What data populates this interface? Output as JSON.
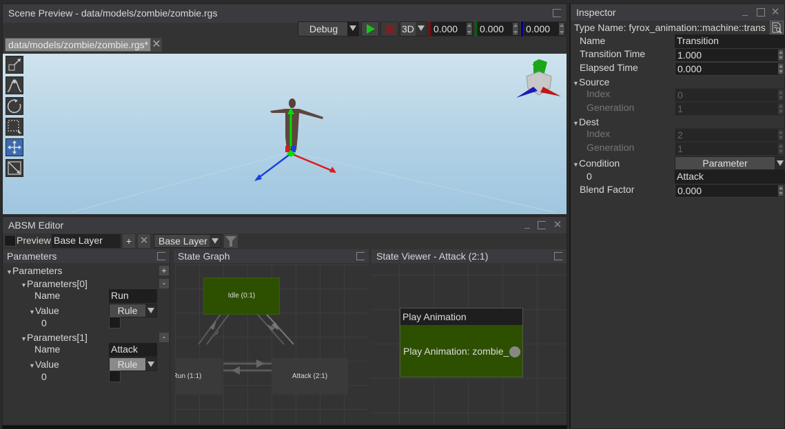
{
  "scene_preview": {
    "title": "Scene Preview - data/models/zombie/zombie.rgs",
    "mode_dropdown": "Debug",
    "play_icon": "play-icon",
    "stop_icon": "stop-icon",
    "view_dropdown": "3D",
    "coords": {
      "x": "0.000",
      "y": "0.000",
      "z": "0.000"
    },
    "axis_colors": {
      "x": "#8b0000",
      "y": "#006400",
      "z": "#00008b"
    },
    "tab": {
      "label": "data/models/zombie/zombie.rgs*",
      "close_icon": "close-icon"
    },
    "tools": [
      {
        "name": "select-link-tool",
        "icon": "link-icon",
        "active": false
      },
      {
        "name": "terrain-tool",
        "icon": "mountain-icon",
        "active": false
      },
      {
        "name": "rotate-tool",
        "icon": "rotate-icon",
        "active": false
      },
      {
        "name": "select-rect-tool",
        "icon": "select-rect-icon",
        "active": false
      },
      {
        "name": "move-tool",
        "icon": "move-icon",
        "active": true
      },
      {
        "name": "scale-tool",
        "icon": "scale-icon",
        "active": false
      }
    ]
  },
  "inspector": {
    "title": "Inspector",
    "type_name": "Type Name: fyrox_animation::machine::trans",
    "fields": {
      "name": {
        "label": "Name",
        "value": "Transition"
      },
      "transition_time": {
        "label": "Transition Time",
        "value": "1.000"
      },
      "elapsed_time": {
        "label": "Elapsed Time",
        "value": "0.000"
      },
      "source": {
        "label": "Source",
        "index_label": "Index",
        "index": "0",
        "generation_label": "Generation",
        "generation": "1"
      },
      "dest": {
        "label": "Dest",
        "index_label": "Index",
        "index": "2",
        "generation_label": "Generation",
        "generation": "1"
      },
      "condition": {
        "label": "Condition",
        "dropdown": "Parameter",
        "item_label": "0",
        "item_value": "Attack"
      },
      "blend_factor": {
        "label": "Blend Factor",
        "value": "0.000"
      }
    }
  },
  "absm_editor": {
    "title": "ABSM Editor",
    "preview_label": "Preview",
    "layer_name_input": "Base Layer",
    "add_label": "+",
    "layer_dropdown": "Base Layer",
    "parameters_panel": {
      "title": "Parameters",
      "root_label": "Parameters",
      "add_label": "+",
      "items": [
        {
          "label": "Parameters[0]",
          "remove_label": "-",
          "name_label": "Name",
          "name": "Run",
          "value_label": "Value",
          "value_type": "Rule",
          "sub_label": "0"
        },
        {
          "label": "Parameters[1]",
          "remove_label": "-",
          "name_label": "Name",
          "name": "Attack",
          "value_label": "Value",
          "value_type": "Rule",
          "sub_label": "0"
        }
      ]
    },
    "state_graph": {
      "title": "State Graph",
      "nodes": [
        {
          "label": "Idle (0:1)",
          "active": true
        },
        {
          "label": "Run (1:1)",
          "active": false
        },
        {
          "label": "Attack (2:1)",
          "active": false
        }
      ]
    },
    "state_viewer": {
      "title": "State Viewer - Attack (2:1)",
      "node_header": "Play Animation",
      "node_body": "Play Animation: zombie_"
    }
  }
}
